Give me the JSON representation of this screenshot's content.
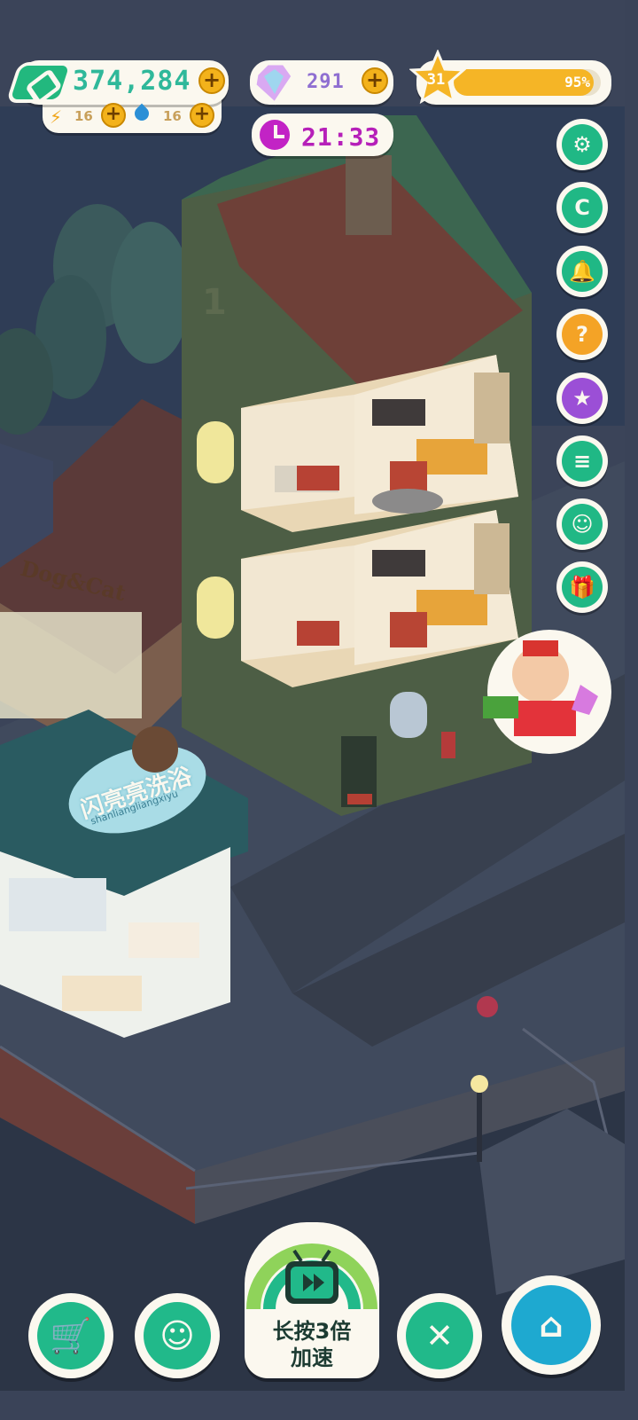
{
  "hud": {
    "cash": "374,284",
    "energy": "16",
    "water": "16",
    "gems": "291",
    "timer": "21:33",
    "level": "31",
    "xp_percent_label": "95%",
    "xp_fraction": 0.95
  },
  "side_buttons": [
    {
      "name": "settings-button",
      "icon": "gear-icon",
      "glyph": "⚙"
    },
    {
      "name": "coupon-button",
      "icon": "coupon-icon",
      "glyph": "C"
    },
    {
      "name": "notification-button",
      "icon": "bell-icon",
      "glyph": "🔔"
    },
    {
      "name": "mystery-box-button",
      "icon": "mystery-box-icon",
      "glyph": "?"
    },
    {
      "name": "album-button",
      "icon": "star-book-icon",
      "glyph": "★"
    },
    {
      "name": "notes-button",
      "icon": "notes-icon",
      "glyph": "≡"
    },
    {
      "name": "chat-button",
      "icon": "chat-ghost-icon",
      "glyph": "☺"
    },
    {
      "name": "gift-button",
      "icon": "gift-icon",
      "glyph": "🎁"
    }
  ],
  "shops": {
    "pet_shop_sign": "Dog&Cat",
    "bath_shop_sign": "闪亮亮洗浴",
    "bath_shop_sub": "shanliangliangxiyu",
    "house_number": "1"
  },
  "bottom_nav": {
    "speed_label_line1": "长按3倍",
    "speed_label_line2": "加速"
  },
  "colors": {
    "accent_green": "#21b98a",
    "cash_text": "#2fb89a",
    "gem_text": "#8f6fd1",
    "timer_purple": "#b620b9",
    "xp_fill": "#f5b526"
  }
}
